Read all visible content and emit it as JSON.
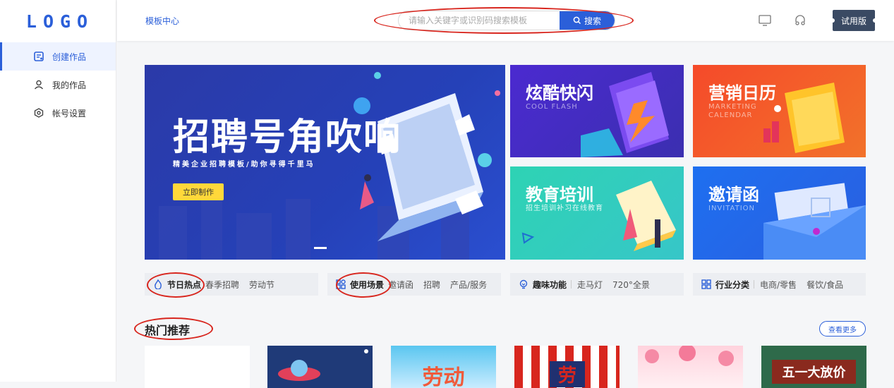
{
  "sidebar": {
    "logo": "LOGO",
    "items": [
      {
        "label": "创建作品",
        "icon": "create-icon",
        "active": true
      },
      {
        "label": "我的作品",
        "icon": "user-icon",
        "active": false
      },
      {
        "label": "帐号设置",
        "icon": "settings-icon",
        "active": false
      }
    ]
  },
  "topbar": {
    "breadcrumb": "模板中心",
    "search": {
      "placeholder": "请输入关键字或识别码搜索模板",
      "button": "搜索"
    },
    "icons": [
      "monitor-icon",
      "headset-icon"
    ],
    "trial": "试用版"
  },
  "hero": {
    "title": "招聘号角吹响",
    "subtitle": "精美企业招聘模板/助你寻得千里马",
    "button": "立即制作"
  },
  "tiles": [
    {
      "title": "炫酷快闪",
      "subtitle": "COOL FLASH"
    },
    {
      "title": "营销日历",
      "subtitle": "MARKETING CALENDAR"
    },
    {
      "title": "教育培训",
      "subtitle": "招生培训补习在线教育"
    },
    {
      "title": "邀请函",
      "subtitle": "INVITATION"
    }
  ],
  "categories": [
    {
      "name": "节日热点",
      "icon": "flame-icon",
      "tags": [
        "春季招聘",
        "劳动节"
      ]
    },
    {
      "name": "使用场景",
      "icon": "scene-icon",
      "tags": [
        "邀请函",
        "招聘",
        "产品/服务"
      ]
    },
    {
      "name": "趣味功能",
      "icon": "bulb-icon",
      "tags": [
        "走马灯",
        "720°全景"
      ]
    },
    {
      "name": "行业分类",
      "icon": "grid-icon",
      "tags": [
        "电商/零售",
        "餐饮/食品"
      ]
    }
  ],
  "hot": {
    "title": "热门推荐",
    "more": "查看更多"
  },
  "thumbs": [
    {
      "text": ""
    },
    {
      "text": ""
    },
    {
      "text": "劳动"
    },
    {
      "text": "劳"
    },
    {
      "text": ""
    },
    {
      "text": "五一大放价"
    }
  ],
  "colors": {
    "accent": "#2b5fd9",
    "annotation": "#d8261e",
    "trial_bg": "#3a4a63"
  }
}
